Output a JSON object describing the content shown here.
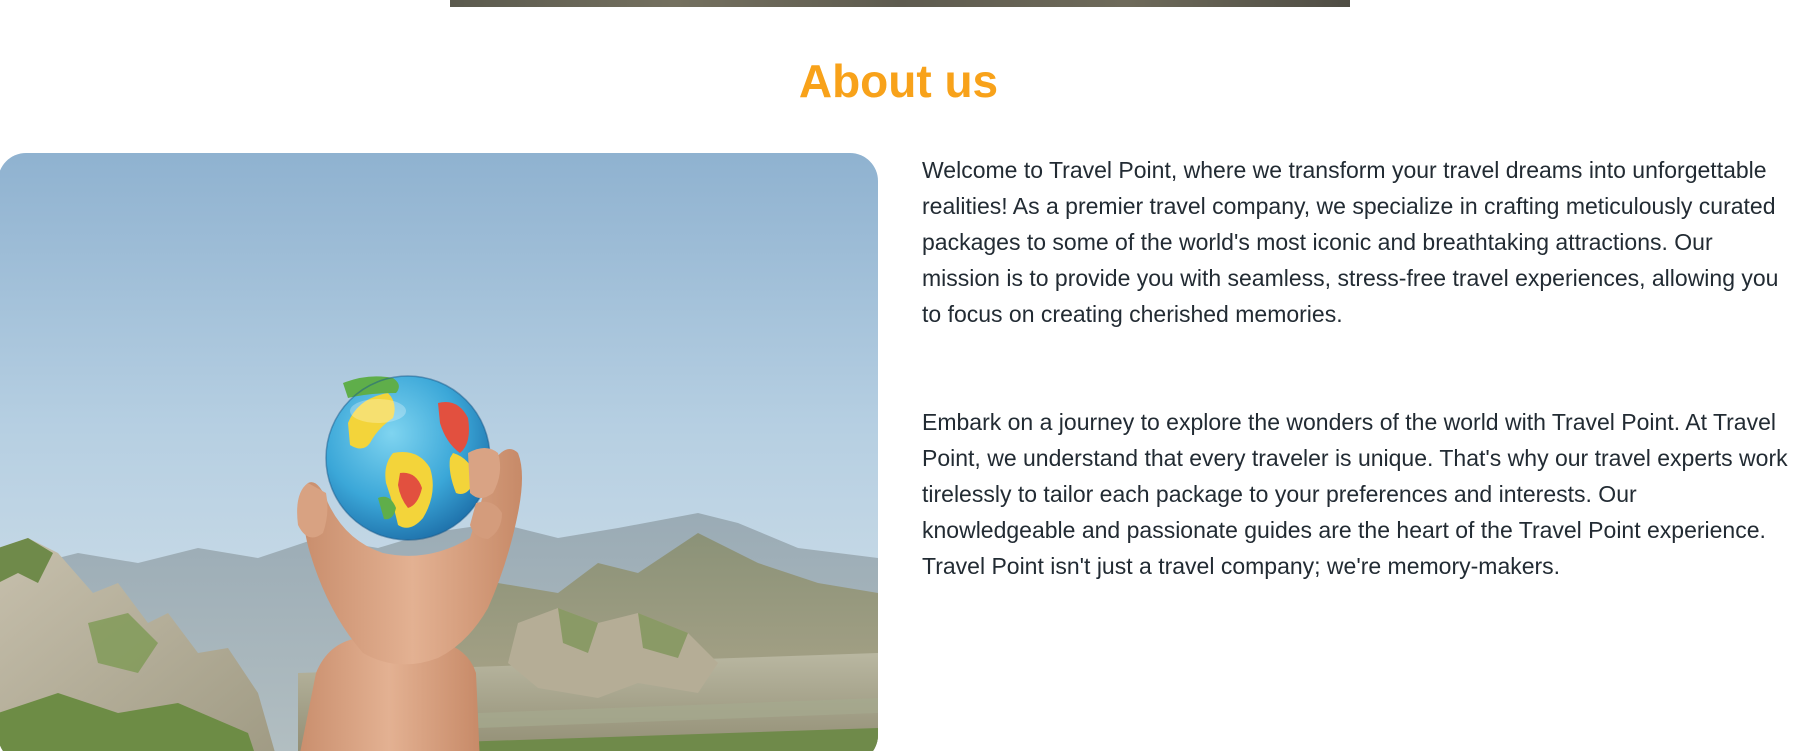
{
  "about": {
    "title": "About us",
    "accent_color": "#f8a21a",
    "image_description_icon": "globe-in-hand-photo",
    "paragraph_1": "Welcome to Travel Point, where we transform your travel dreams into unforgettable\nrealities! As a premier travel company, we specialize in crafting meticulously curated\npackages to some of the world's most iconic and breathtaking attractions. Our\nmission is to provide you with seamless, stress-free travel experiences, allowing you\nto focus on creating cherished memories.",
    "paragraph_2": "Embark on a journey to explore the wonders of the world with Travel Point. At Travel\nPoint, we understand that every traveler is unique. That's why our travel experts work\ntirelessly to tailor each package to your preferences and interests. Our\nknowledgeable and passionate guides are the heart of the Travel Point experience.\nTravel Point isn't just a travel company; we're memory-makers."
  }
}
